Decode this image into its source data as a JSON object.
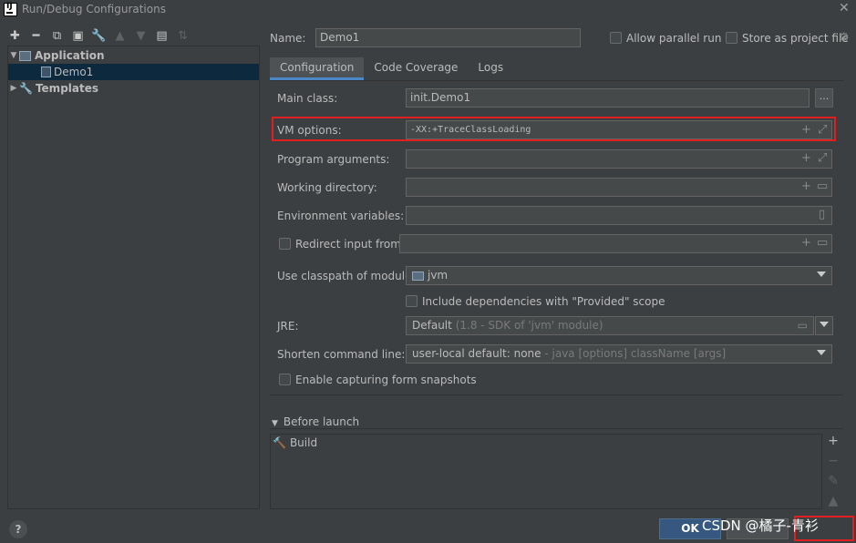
{
  "window": {
    "title": "Run/Debug Configurations"
  },
  "toolbar": {
    "icons": [
      "add-icon",
      "remove-icon",
      "copy-icon",
      "save-icon",
      "wrench-icon",
      "move-up-icon",
      "move-down-icon",
      "new-folder-icon",
      "sort-icon"
    ]
  },
  "tree": {
    "items": [
      {
        "label": "Application",
        "expanded": true
      },
      {
        "label": "Demo1",
        "selected": true
      },
      {
        "label": "Templates",
        "expanded": false
      }
    ]
  },
  "header": {
    "name_label": "Name:",
    "name_value": "Demo1",
    "allow_parallel_label": "Allow parallel run",
    "store_project_label": "Store as project file"
  },
  "tabs": [
    "Configuration",
    "Code Coverage",
    "Logs"
  ],
  "form": {
    "main_class_label": "Main class:",
    "main_class_value": "init.Demo1",
    "browse_label": "...",
    "vm_options_label": "VM options:",
    "vm_options_value": "-XX:+TraceClassLoading",
    "program_args_label": "Program arguments:",
    "working_dir_label": "Working directory:",
    "env_vars_label": "Environment variables:",
    "redirect_label": "Redirect input from:",
    "classpath_label": "Use classpath of module:",
    "classpath_value": "jvm",
    "include_deps_label": "Include dependencies with \"Provided\" scope",
    "jre_label": "JRE:",
    "jre_value": "Default",
    "jre_hint": "(1.8 - SDK of 'jvm' module)",
    "shorten_label": "Shorten command line:",
    "shorten_value": "user-local default: none",
    "shorten_hint": "- java [options] className [args]",
    "snapshots_label": "Enable capturing form snapshots"
  },
  "before_launch": {
    "label": "Before launch",
    "items": [
      "Build"
    ]
  },
  "buttons": {
    "ok": "OK",
    "help": "?"
  },
  "watermark": "CSDN @橘子-青衫",
  "colors": {
    "accent": "#4a88c7",
    "highlight_border": "#e02020",
    "ok_button": "#365880"
  }
}
